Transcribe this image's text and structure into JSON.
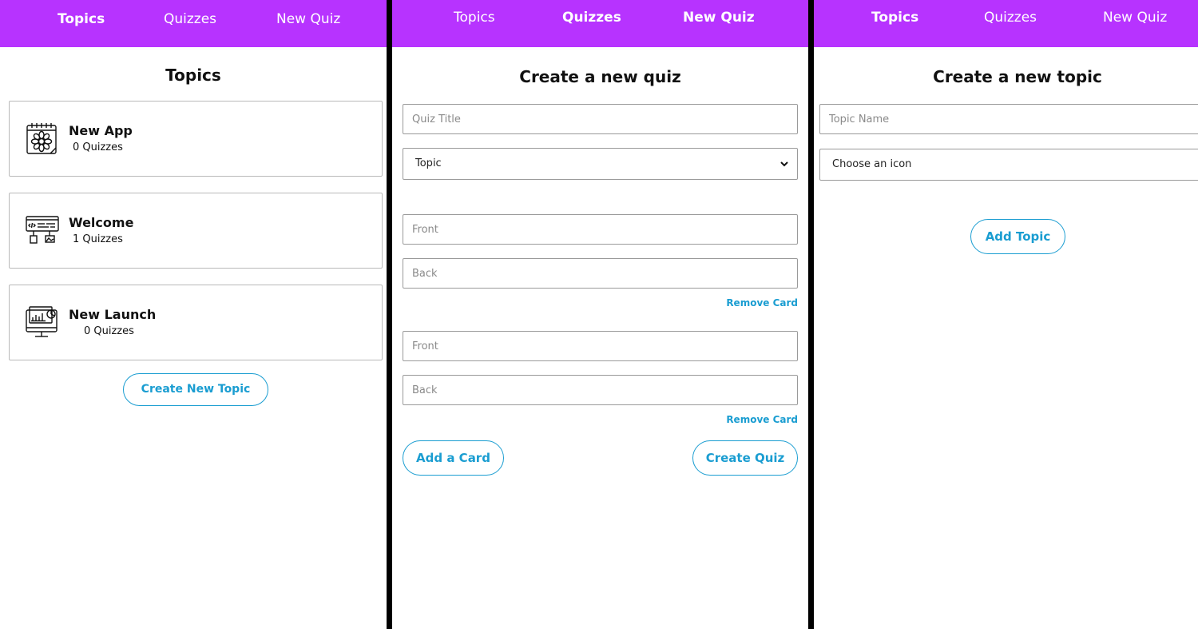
{
  "panels": [
    {
      "nav": {
        "topics": "Topics",
        "quizzes": "Quizzes",
        "new_quiz": "New Quiz",
        "active": "topics"
      },
      "title": "Topics",
      "topics": [
        {
          "name": "New App",
          "count": "0 Quizzes",
          "icon": "calendar-flower-icon"
        },
        {
          "name": "Welcome",
          "count": "1 Quizzes",
          "icon": "code-window-icon"
        },
        {
          "name": "New Launch",
          "count": "0 Quizzes",
          "icon": "monitor-chart-icon"
        }
      ],
      "create_button": "Create New Topic"
    },
    {
      "nav": {
        "topics": "Topics",
        "quizzes": "Quizzes",
        "new_quiz": "New Quiz",
        "active": "quizzes+new_quiz"
      },
      "title": "Create a new quiz",
      "quiz_title_placeholder": "Quiz Title",
      "topic_select": "Topic",
      "cards": [
        {
          "front_placeholder": "Front",
          "back_placeholder": "Back",
          "remove_label": "Remove Card"
        },
        {
          "front_placeholder": "Front",
          "back_placeholder": "Back",
          "remove_label": "Remove Card"
        }
      ],
      "add_card_button": "Add a Card",
      "create_quiz_button": "Create Quiz"
    },
    {
      "nav": {
        "topics": "Topics",
        "quizzes": "Quizzes",
        "new_quiz": "New Quiz",
        "active": "topics"
      },
      "title": "Create a new topic",
      "topic_name_placeholder": "Topic Name",
      "icon_select": "Choose an icon",
      "add_topic_button": "Add Topic"
    }
  ],
  "colors": {
    "nav_bg": "#b733ff",
    "accent": "#1a9dd1",
    "divider": "#000000"
  }
}
